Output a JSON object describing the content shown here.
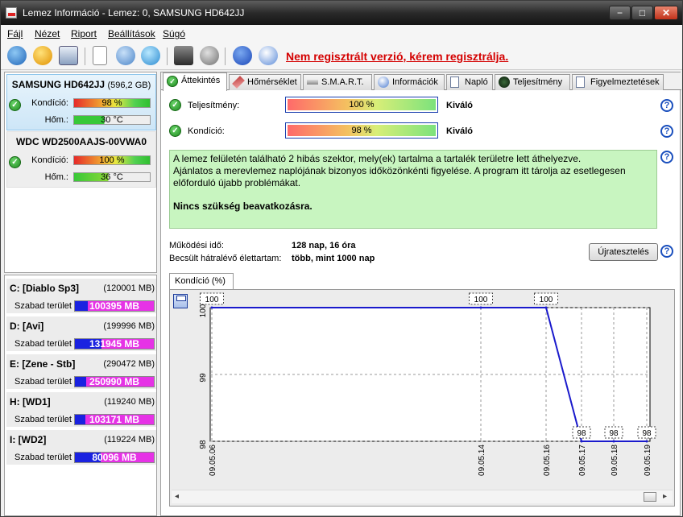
{
  "window": {
    "title": "Lemez Információ - Lemez: 0, SAMSUNG HD642JJ",
    "min": "−",
    "max": "□",
    "close": "✕"
  },
  "menu": [
    "Fájl",
    "Nézet",
    "Riport",
    "Beállítások",
    "Súgó"
  ],
  "toolbar": {
    "icons": [
      "refresh-icon",
      "warning-icon",
      "disk-icon",
      "document-icon",
      "refresh-alt-icon",
      "network-icon",
      "tools-icon",
      "speaker-icon",
      "help-icon",
      "info-icon"
    ],
    "register_link": "Nem regisztrált verzió, kérem regisztrálja."
  },
  "disks": [
    {
      "name": "SAMSUNG HD642JJ",
      "size": "(596,2 GB)",
      "cond_label": "Kondíció:",
      "cond_value": "98 %",
      "cond_pct": 98,
      "temp_label": "Hőm.:",
      "temp_value": "30 °C"
    },
    {
      "name": "WDC WD2500AAJS-00VWA0",
      "size": "",
      "cond_label": "Kondíció:",
      "cond_value": "100 %",
      "cond_pct": 100,
      "temp_label": "Hőm.:",
      "temp_value": "36 °C"
    }
  ],
  "volumes": [
    {
      "name": "C: [Diablo Sp3]",
      "size": "(120001 MB)",
      "free_label": "Szabad terület",
      "free": "100395 MB",
      "used_fraction": 0.16
    },
    {
      "name": "D: [Avi]",
      "size": "(199996 MB)",
      "free_label": "Szabad terület",
      "free": "131945 MB",
      "used_fraction": 0.34
    },
    {
      "name": "E: [Zene - Stb]",
      "size": "(290472 MB)",
      "free_label": "Szabad terület",
      "free": "250990 MB",
      "used_fraction": 0.14
    },
    {
      "name": "H: [WD1]",
      "size": "(119240 MB)",
      "free_label": "Szabad terület",
      "free": "103171 MB",
      "used_fraction": 0.13
    },
    {
      "name": "I: [WD2]",
      "size": "(119224 MB)",
      "free_label": "Szabad terület",
      "free": "80096 MB",
      "used_fraction": 0.33
    }
  ],
  "tabs": [
    "Áttekintés",
    "Hőmérséklet",
    "S.M.A.R.T.",
    "Információk",
    "Napló",
    "Teljesítmény",
    "Figyelmeztetések"
  ],
  "overview": {
    "performance": {
      "label": "Teljesítmény:",
      "value": "100 %",
      "verdict": "Kiváló"
    },
    "health": {
      "label": "Kondíció:",
      "value": "98 %",
      "verdict": "Kiváló"
    },
    "status_lines": [
      "A lemez felületén található 2 hibás szektor, mely(ek) tartalma a tartalék területre lett áthelyezve.",
      "Ajánlatos a merevlemez naplójának bizonyos időközönkénti figyelése. A program itt tárolja az esetlegesen előforduló újabb problémákat."
    ],
    "status_action": "Nincs szükség beavatkozásra.",
    "uptime_label": "Működési idő:",
    "uptime_value": "128 nap, 16 óra",
    "lifetime_label": "Becsült hátralévő élettartam:",
    "lifetime_value": "több, mint 1000 nap",
    "reset_button": "Újratesztelés",
    "help_glyph": "?"
  },
  "chart_tab": "Kondíció  (%)",
  "chart_data": {
    "type": "line",
    "title": "",
    "x": [
      "09.05.06",
      "09.05.14",
      "09.05.16",
      "09.05.17",
      "09.05.18",
      "09.05.19"
    ],
    "y": [
      100,
      100,
      100,
      98,
      98,
      98
    ],
    "ylim": [
      98,
      100
    ],
    "yticks": [
      "100",
      "99",
      "98"
    ],
    "grid": true,
    "line_color": "#1a1acc"
  }
}
